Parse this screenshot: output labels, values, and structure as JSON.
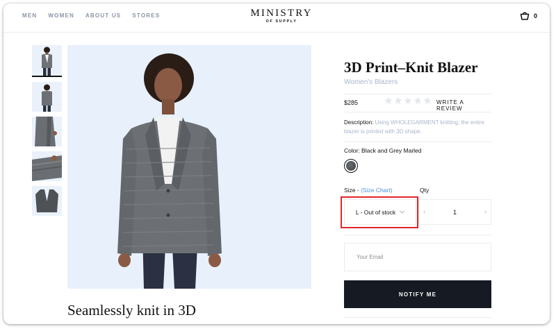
{
  "header": {
    "nav": [
      {
        "label": "MEN"
      },
      {
        "label": "WOMEN"
      },
      {
        "label": "ABOUT US"
      },
      {
        "label": "STORES"
      }
    ],
    "logo_main": "MINISTRY",
    "logo_sub": "OF SUPPLY",
    "cart_count": "0"
  },
  "gallery": {
    "thumbnails": [
      "front-view",
      "back-view",
      "detail-side",
      "detail-sleeve",
      "flat-lay"
    ],
    "active_index": 0,
    "main_image": "model-wearing-blazer"
  },
  "tagline": "Seamlessly knit in 3D",
  "product": {
    "title": "3D Print–Knit Blazer",
    "category": "Women's Blazers",
    "price": "$285",
    "rating": 0,
    "rating_max": 5,
    "write_review": "WRITE A REVIEW",
    "description_label": "Description:",
    "description_text": " Using WHOLEGARMENT knitting, the entire blazer is printed with 3D shape.",
    "color_label": "Color: Black and Grey Marled",
    "size_label": "Size - ",
    "size_chart": "(Size Chart)",
    "qty_label": "Qty",
    "size_value": "L - Out of stock",
    "qty_value": "1",
    "email_placeholder": "Your Email",
    "notify_label": "NOTIFY ME"
  },
  "colors": {
    "accent_dark": "#151a23",
    "muted_blue": "#a9b6cc",
    "link_blue": "#4a90e2",
    "highlight_red": "#e0242a"
  }
}
